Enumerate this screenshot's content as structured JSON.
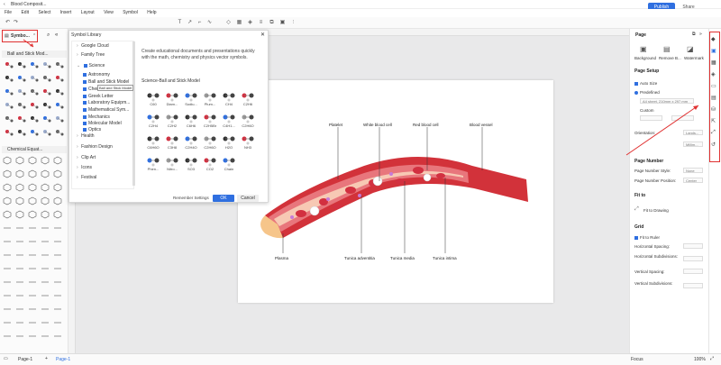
{
  "app": {
    "doc_title": "Blood Composit...",
    "publish": "Publish",
    "share": "Share"
  },
  "menu": [
    "File",
    "Edit",
    "Select",
    "Insert",
    "Layout",
    "View",
    "Symbol",
    "Help"
  ],
  "left": {
    "symbols_tab": "Symbo...",
    "sections": [
      "Ball and Stick Mod...",
      "Chemical Equat..."
    ]
  },
  "dialog": {
    "title": "Symbol Library",
    "tree": [
      {
        "label": "Google Cloud",
        "checked": false,
        "level": 0
      },
      {
        "label": "Family Tree",
        "checked": false,
        "level": 0
      },
      {
        "label": "Science",
        "checked": true,
        "level": 0
      },
      {
        "label": "Astronomy",
        "checked": true,
        "level": 1
      },
      {
        "label": "Ball and Stick Model",
        "checked": true,
        "level": 1
      },
      {
        "label": "Chemi...",
        "checked": true,
        "level": 1
      },
      {
        "label": "Greek Letter",
        "checked": true,
        "level": 1
      },
      {
        "label": "Laboratory Equipm...",
        "checked": true,
        "level": 1
      },
      {
        "label": "Mathematical Sym...",
        "checked": true,
        "level": 1
      },
      {
        "label": "Mechanics",
        "checked": true,
        "level": 1
      },
      {
        "label": "Molecular Model",
        "checked": true,
        "level": 1
      },
      {
        "label": "Optics",
        "checked": true,
        "level": 1
      },
      {
        "label": "Health",
        "checked": false,
        "level": 0
      },
      {
        "label": "Fashion Design",
        "checked": false,
        "level": 0
      },
      {
        "label": "Clip Art",
        "checked": false,
        "level": 0
      },
      {
        "label": "Icons",
        "checked": false,
        "level": 0
      },
      {
        "label": "Festival",
        "checked": false,
        "level": 0
      }
    ],
    "tooltip": "Ball and Stick Model",
    "description": "Create educational documents and presentations quickly with the math, chemistry and physics vector symbols.",
    "library_heading": "Science-Ball and Stick Model",
    "symbols": [
      "C60",
      "Diam...",
      "Sodiu...",
      "Plum...",
      "CH4",
      "C2H6",
      "C2H4",
      "C2H2",
      "C6H6",
      "C2H5Br",
      "C4H1...",
      "C2H6O",
      "C6H6O",
      "C3H8",
      "C2H4O",
      "C2H6O",
      "H2O",
      "NH3",
      "Phen...",
      "Nitro...",
      "SO3",
      "CO2",
      "Chain"
    ],
    "remember": "Remember Settings",
    "ok": "OK",
    "cancel": "Cancel"
  },
  "diagram": {
    "labels": [
      "Platelet",
      "White blood cell",
      "Red blood cell",
      "Blood vessel",
      "Plasma",
      "Tunica adventitia",
      "Tunica media",
      "Tunica intima"
    ],
    "colors": {
      "vessel": "#d2323a",
      "wall": "#e8767c",
      "lumen": "#f7c9b4",
      "rbc": "#d23040",
      "wbc": "#ffffff",
      "platelet": "#c77ad8",
      "plasma": "#f6c58a"
    }
  },
  "right": {
    "page_heading": "Page",
    "tabs": [
      "Background",
      "Remove B...",
      "Watermark"
    ],
    "page_setup": "Page Setup",
    "auto_size": "Auto Size",
    "predefined": "Predefined",
    "size_value": "A4 sheet, 210mm x 297 mm",
    "custom": "Custom",
    "orientation": "Orientation:",
    "orientation_value": "Lands...",
    "unit_value": "Millim...",
    "page_number": "Page Number",
    "pn_style": "Page Number Style:",
    "pn_style_value": "None",
    "pn_position": "Page Number Position:",
    "pn_position_value": "Center",
    "fit_to": "Fit to",
    "fit_drawing": "Fit to Drawing",
    "grid": "Grid",
    "fit_ruler": "Fit to Ruler",
    "h_spacing": "Horizontal Spacing:",
    "h_sub": "Horizontal Subdivisions:",
    "v_spacing": "Vertical Spacing:",
    "v_sub": "Vertical Subdivisions:"
  },
  "status": {
    "page_tab": "Page-1",
    "page_tab2": "Page-1",
    "focus": "Focus",
    "zoom": "100%"
  },
  "accent": "#2f6fe0",
  "highlight": "#e03030"
}
